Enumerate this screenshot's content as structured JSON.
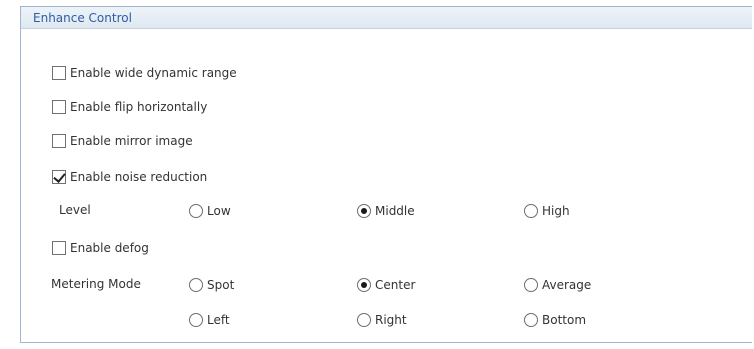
{
  "panel": {
    "title": "Enhance Control"
  },
  "options": {
    "wide_dynamic_range": {
      "label": "Enable wide dynamic range",
      "checked": false
    },
    "flip_horizontally": {
      "label": "Enable flip horizontally",
      "checked": false
    },
    "mirror_image": {
      "label": "Enable mirror image",
      "checked": false
    },
    "noise_reduction": {
      "label": "Enable noise reduction",
      "checked": true
    },
    "defog": {
      "label": "Enable defog",
      "checked": false
    }
  },
  "noise_level": {
    "label": "Level",
    "choices": [
      "Low",
      "Middle",
      "High"
    ],
    "selected": "Middle"
  },
  "metering_mode": {
    "label": "Metering Mode",
    "choices": [
      "Spot",
      "Center",
      "Average",
      "Left",
      "Right",
      "Bottom"
    ],
    "selected": "Center"
  }
}
